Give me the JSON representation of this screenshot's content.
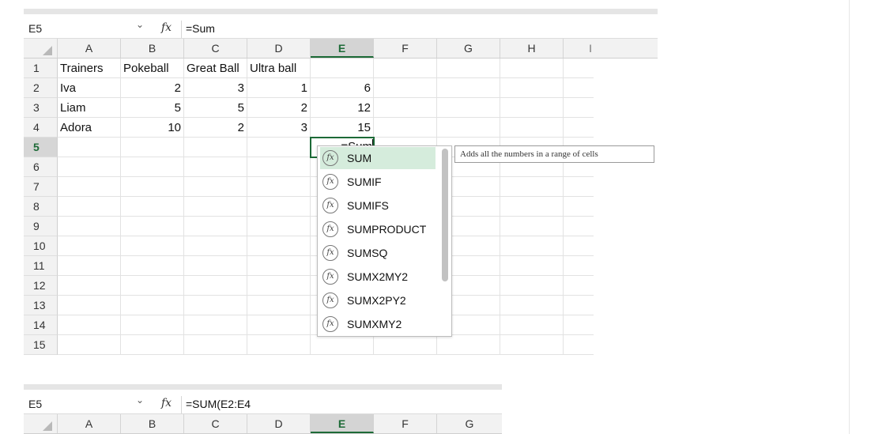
{
  "top_sheet": {
    "name_box": "E5",
    "fx_label": "fx",
    "formula": "=Sum",
    "columns": [
      "A",
      "B",
      "C",
      "D",
      "E",
      "F",
      "G",
      "H",
      "I"
    ],
    "rows": [
      {
        "n": "1",
        "cells": [
          "Trainers",
          "Pokeball",
          "Great Ball",
          "Ultra ball",
          "",
          "",
          "",
          "",
          ""
        ]
      },
      {
        "n": "2",
        "cells": [
          "Iva",
          "2",
          "3",
          "1",
          "6",
          "",
          "",
          "",
          ""
        ]
      },
      {
        "n": "3",
        "cells": [
          "Liam",
          "5",
          "5",
          "2",
          "12",
          "",
          "",
          "",
          ""
        ]
      },
      {
        "n": "4",
        "cells": [
          "Adora",
          "10",
          "2",
          "3",
          "15",
          "",
          "",
          "",
          ""
        ]
      },
      {
        "n": "5",
        "cells": [
          "",
          "",
          "",
          "",
          "",
          "",
          "",
          "",
          ""
        ]
      },
      {
        "n": "6",
        "cells": [
          "",
          "",
          "",
          "",
          "",
          "",
          "",
          "",
          ""
        ]
      },
      {
        "n": "7",
        "cells": [
          "",
          "",
          "",
          "",
          "",
          "",
          "",
          "",
          ""
        ]
      },
      {
        "n": "8",
        "cells": [
          "",
          "",
          "",
          "",
          "",
          "",
          "",
          "",
          ""
        ]
      },
      {
        "n": "9",
        "cells": [
          "",
          "",
          "",
          "",
          "",
          "",
          "",
          "",
          ""
        ]
      },
      {
        "n": "10",
        "cells": [
          "",
          "",
          "",
          "",
          "",
          "",
          "",
          "",
          ""
        ]
      },
      {
        "n": "11",
        "cells": [
          "",
          "",
          "",
          "",
          "",
          "",
          "",
          "",
          ""
        ]
      },
      {
        "n": "12",
        "cells": [
          "",
          "",
          "",
          "",
          "",
          "",
          "",
          "",
          ""
        ]
      },
      {
        "n": "13",
        "cells": [
          "",
          "",
          "",
          "",
          "",
          "",
          "",
          "",
          ""
        ]
      },
      {
        "n": "14",
        "cells": [
          "",
          "",
          "",
          "",
          "",
          "",
          "",
          "",
          ""
        ]
      },
      {
        "n": "15",
        "cells": [
          "",
          "",
          "",
          "",
          "",
          "",
          "",
          "",
          ""
        ]
      }
    ],
    "active_cell_text": "=Sum",
    "autocomplete": [
      "SUM",
      "SUMIF",
      "SUMIFS",
      "SUMPRODUCT",
      "SUMSQ",
      "SUMX2MY2",
      "SUMX2PY2",
      "SUMXMY2"
    ],
    "autocomplete_icon_text": "fx",
    "tooltip": "Adds all the numbers in a range of cells"
  },
  "bottom_sheet": {
    "name_box": "E5",
    "fx_label": "fx",
    "formula": "=SUM(E2:E4",
    "columns": [
      "A",
      "B",
      "C",
      "D",
      "E",
      "F",
      "G"
    ]
  },
  "colors": {
    "accent": "#1d6a37",
    "highlight": "#d5ecdc"
  }
}
